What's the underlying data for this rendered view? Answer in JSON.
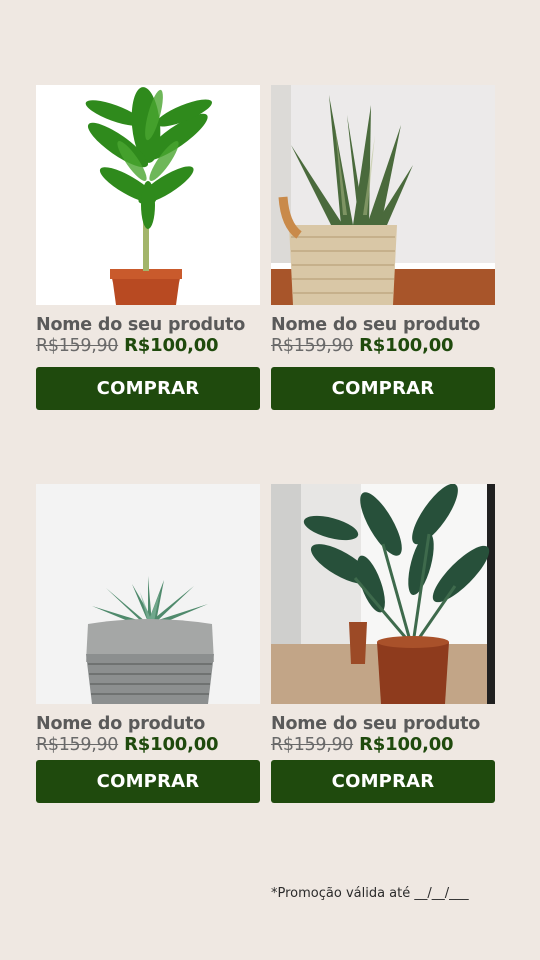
{
  "products": [
    {
      "name": "Nome do seu produto",
      "old_price": "R$159,90",
      "new_price": "R$100,00",
      "button": "COMPRAR",
      "image": "dracaena-plant-in-terracotta-pot"
    },
    {
      "name": "Nome do seu produto",
      "old_price": "R$159,90",
      "new_price": "R$100,00",
      "button": "COMPRAR",
      "image": "snake-plant-in-woven-basket"
    },
    {
      "name": "Nome do produto",
      "old_price": "R$159,90",
      "new_price": "R$100,00",
      "button": "COMPRAR",
      "image": "succulent-in-gray-pot"
    },
    {
      "name": "Nome do seu produto",
      "old_price": "R$159,90",
      "new_price": "R$100,00",
      "button": "COMPRAR",
      "image": "bird-of-paradise-in-terracotta-pot"
    }
  ],
  "footnote": "*Promoção válida até __/__/___",
  "colors": {
    "background": "#efe8e2",
    "button": "#1f4a0d",
    "new_price": "#1f4a0d",
    "text": "#5a5a5a"
  }
}
